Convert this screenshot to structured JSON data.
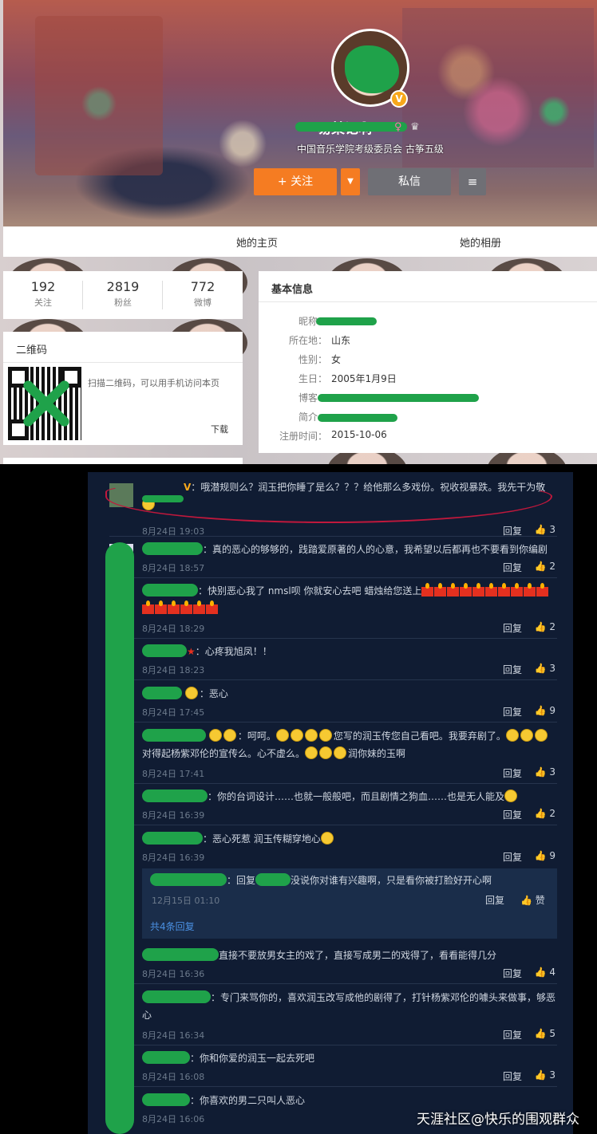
{
  "profile": {
    "nickname": "易某记啊",
    "verify_desc": "中国音乐学院考级委员会 古筝五级",
    "follow_label": "+ 关注",
    "message_label": "私信",
    "more_label": "≡",
    "vip_badge": "V"
  },
  "tabs": {
    "home": "她的主页",
    "album": "她的相册"
  },
  "counts": [
    {
      "num": "192",
      "label": "关注"
    },
    {
      "num": "2819",
      "label": "粉丝"
    },
    {
      "num": "772",
      "label": "微博"
    }
  ],
  "qr": {
    "title": "二维码",
    "desc": "扫描二维码，可以用手机访问本页",
    "download": "下载"
  },
  "info": {
    "title": "基本信息",
    "rows": [
      {
        "k": "昵称：",
        "v": ""
      },
      {
        "k": "所在地：",
        "v": "山东"
      },
      {
        "k": "性别：",
        "v": "女"
      },
      {
        "k": "生日：",
        "v": "2005年1月9日"
      },
      {
        "k": "博客：",
        "v": ""
      },
      {
        "k": "简介：",
        "v": ""
      },
      {
        "k": "注册时间：",
        "v": "2015-10-06"
      }
    ]
  },
  "comments": [
    {
      "text": "：哦潜规则么？润玉把你睡了是么？？？给他那么多戏份。祝收视暴跌。我先干为敬",
      "time": "8月24日 19:03",
      "likes": "3"
    },
    {
      "text": "：真的恶心的够够的，践踏爱原著的人的心意，我希望以后都再也不要看到你编剧",
      "time": "8月24日 18:57",
      "likes": "2"
    },
    {
      "text": "：快别恶心我了  nmsl呗  你就安心去吧  蜡烛给您送上",
      "time": "8月24日 18:29",
      "likes": "2"
    },
    {
      "text": "：心疼我旭凤！！",
      "time": "8月24日 18:23",
      "likes": "3"
    },
    {
      "text": "：恶心",
      "time": "8月24日 17:45",
      "likes": "9"
    },
    {
      "text": "：呵呵。",
      "text2": "您写的润玉传您自己看吧。我要弃剧了。",
      "text3": "对得起杨紫邓伦的宣传么。心不虚么。",
      "text4": "润你妹的玉啊",
      "time": "8月24日 17:41",
      "likes": "3"
    },
    {
      "text": "：你的台词设计……也就一般般吧，而且剧情之狗血……也是无人能及",
      "time": "8月24日 16:39",
      "likes": "2"
    },
    {
      "text": "：恶心死惹 润玉传糊穿地心",
      "time": "8月24日 16:39",
      "likes": "9"
    },
    {
      "text": "直接不要放男女主的戏了，直接写成男二的戏得了，看看能得几分",
      "time": "8月24日 16:36",
      "likes": "4"
    },
    {
      "text": "：专门来骂你的，喜欢润玉改写成他的剧得了，打针杨紫邓伦的噱头来做事，够恶",
      "text2": "心",
      "time": "8月24日 16:34",
      "likes": "5"
    },
    {
      "text": "：你和你爱的润玉一起去死吧",
      "time": "8月24日 16:08",
      "likes": "3"
    },
    {
      "text": "：你喜欢的男二只叫人恶心",
      "time": "8月24日 16:06",
      "likes": ""
    }
  ],
  "subreply": {
    "prefix": "：回复",
    "text": "没说你对谁有兴趣啊，只是看你被打脸好开心啊",
    "time": "12月15日 01:10",
    "reply": "回复",
    "like": "赞",
    "more": "共4条回复"
  },
  "reply_label": "回复",
  "like_icon": "👍",
  "watermark": "天涯社区@快乐的围观群众",
  "colors": {
    "accent": "#f57c22",
    "link": "#4a90e2",
    "dark_bg": "#101c33"
  }
}
